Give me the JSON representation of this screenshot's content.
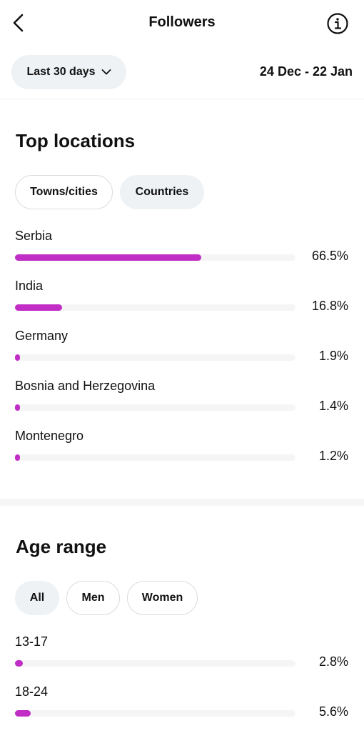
{
  "header": {
    "title": "Followers"
  },
  "filters": {
    "range_label": "Last 30 days",
    "date_range": "24 Dec - 22 Jan"
  },
  "top_locations": {
    "title": "Top locations",
    "tabs": [
      {
        "label": "Towns/cities",
        "selected": false
      },
      {
        "label": "Countries",
        "selected": true
      }
    ],
    "items": [
      {
        "label": "Serbia",
        "percent": "66.5%",
        "value": 66.5
      },
      {
        "label": "India",
        "percent": "16.8%",
        "value": 16.8
      },
      {
        "label": "Germany",
        "percent": "1.9%",
        "value": 1.9
      },
      {
        "label": "Bosnia and Herzegovina",
        "percent": "1.4%",
        "value": 1.4
      },
      {
        "label": "Montenegro",
        "percent": "1.2%",
        "value": 1.2
      }
    ]
  },
  "age_range": {
    "title": "Age range",
    "tabs": [
      {
        "label": "All",
        "selected": true
      },
      {
        "label": "Men",
        "selected": false
      },
      {
        "label": "Women",
        "selected": false
      }
    ],
    "items": [
      {
        "label": "13-17",
        "percent": "2.8%",
        "value": 2.8
      },
      {
        "label": "18-24",
        "percent": "5.6%",
        "value": 5.6
      }
    ]
  },
  "colors": {
    "bar_fill": "#c12ec6",
    "bar_track": "#f5f5f5"
  },
  "icons": [
    "chevron-left-icon",
    "info-icon",
    "chevron-down-icon"
  ]
}
